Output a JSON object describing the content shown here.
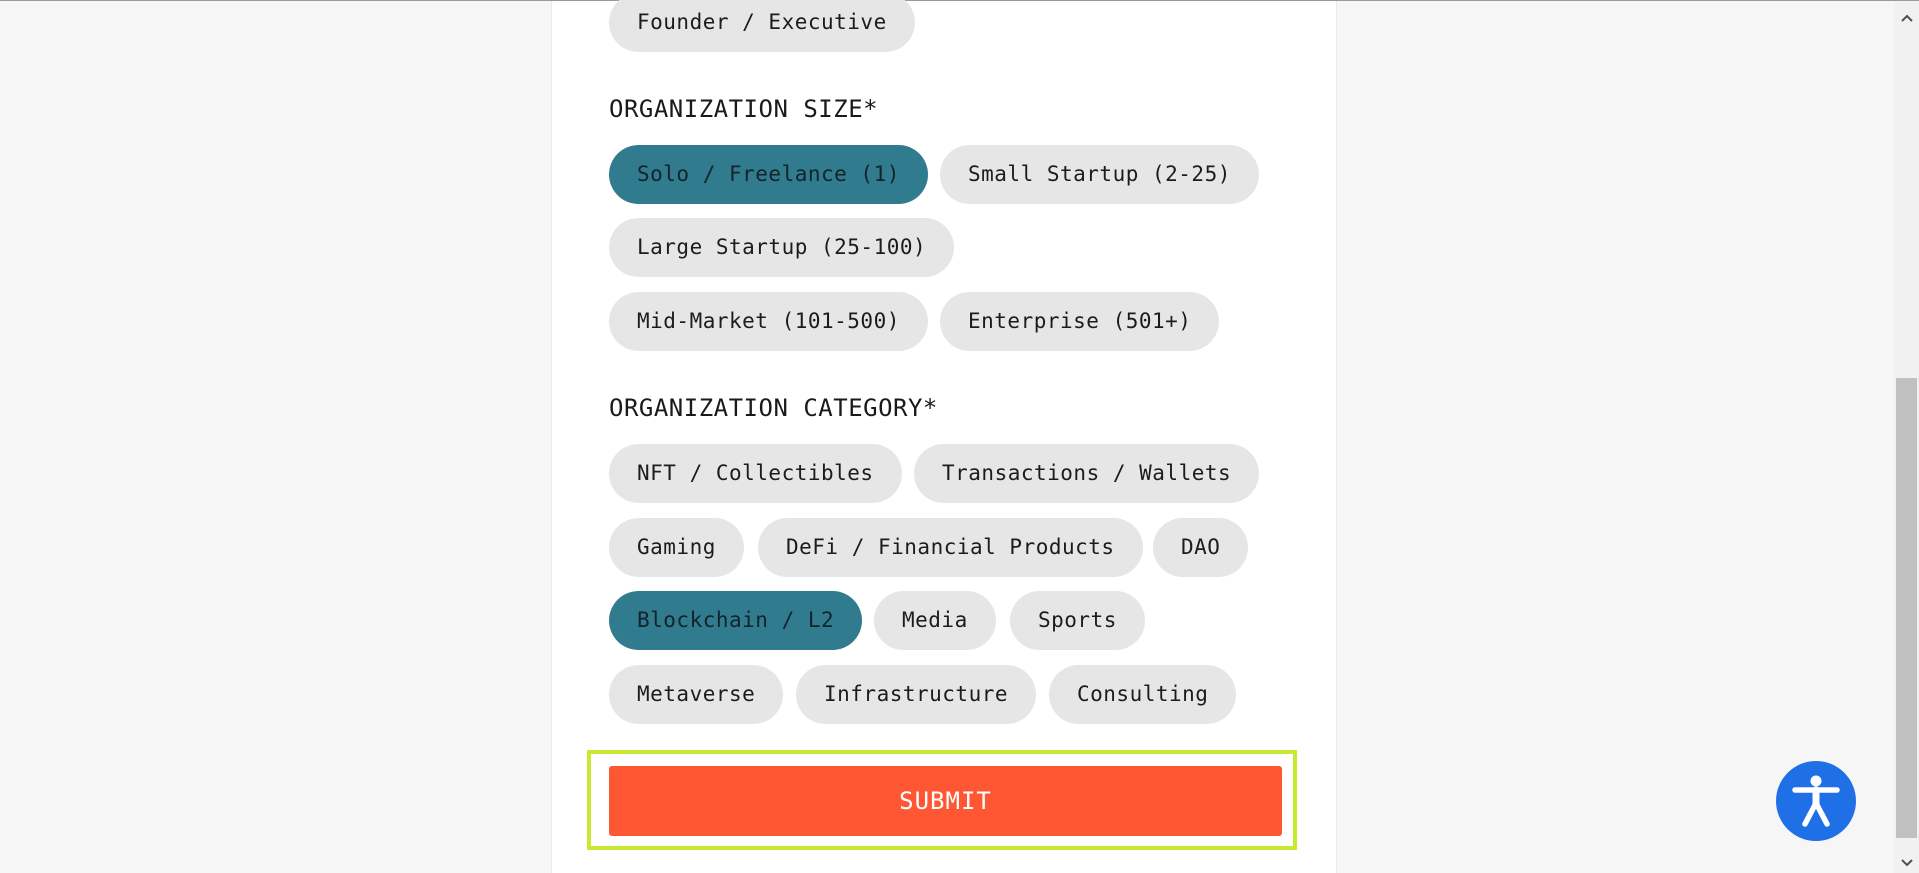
{
  "form": {
    "role_chips": [
      {
        "label": "Founder / Executive",
        "selected": false
      }
    ],
    "org_size": {
      "label": "ORGANIZATION SIZE*",
      "options": [
        {
          "label": "Solo / Freelance (1)",
          "selected": true
        },
        {
          "label": "Small Startup (2-25)",
          "selected": false
        },
        {
          "label": "Large Startup (25-100)",
          "selected": false
        },
        {
          "label": "Mid-Market (101-500)",
          "selected": false
        },
        {
          "label": "Enterprise (501+)",
          "selected": false
        }
      ]
    },
    "org_category": {
      "label": "ORGANIZATION CATEGORY*",
      "options": [
        {
          "label": "NFT / Collectibles",
          "selected": false
        },
        {
          "label": "Transactions / Wallets",
          "selected": false
        },
        {
          "label": "Gaming",
          "selected": false
        },
        {
          "label": "DeFi / Financial Products",
          "selected": false
        },
        {
          "label": "DAO",
          "selected": false
        },
        {
          "label": "Blockchain / L2",
          "selected": true
        },
        {
          "label": "Media",
          "selected": false
        },
        {
          "label": "Sports",
          "selected": false
        },
        {
          "label": "Metaverse",
          "selected": false
        },
        {
          "label": "Infrastructure",
          "selected": false
        },
        {
          "label": "Consulting",
          "selected": false
        }
      ]
    },
    "submit_label": "SUBMIT"
  },
  "accessibility": {
    "icon": "accessibility-person-icon"
  },
  "scrollbar": {
    "up_icon": "chevron-up-icon",
    "down_icon": "chevron-down-icon"
  },
  "colors": {
    "selected_chip": "#317b8e",
    "chip": "#e6e6e6",
    "submit": "#ff5733",
    "focus_outline": "#c6ea30",
    "accessibility": "#1f6fe6"
  }
}
